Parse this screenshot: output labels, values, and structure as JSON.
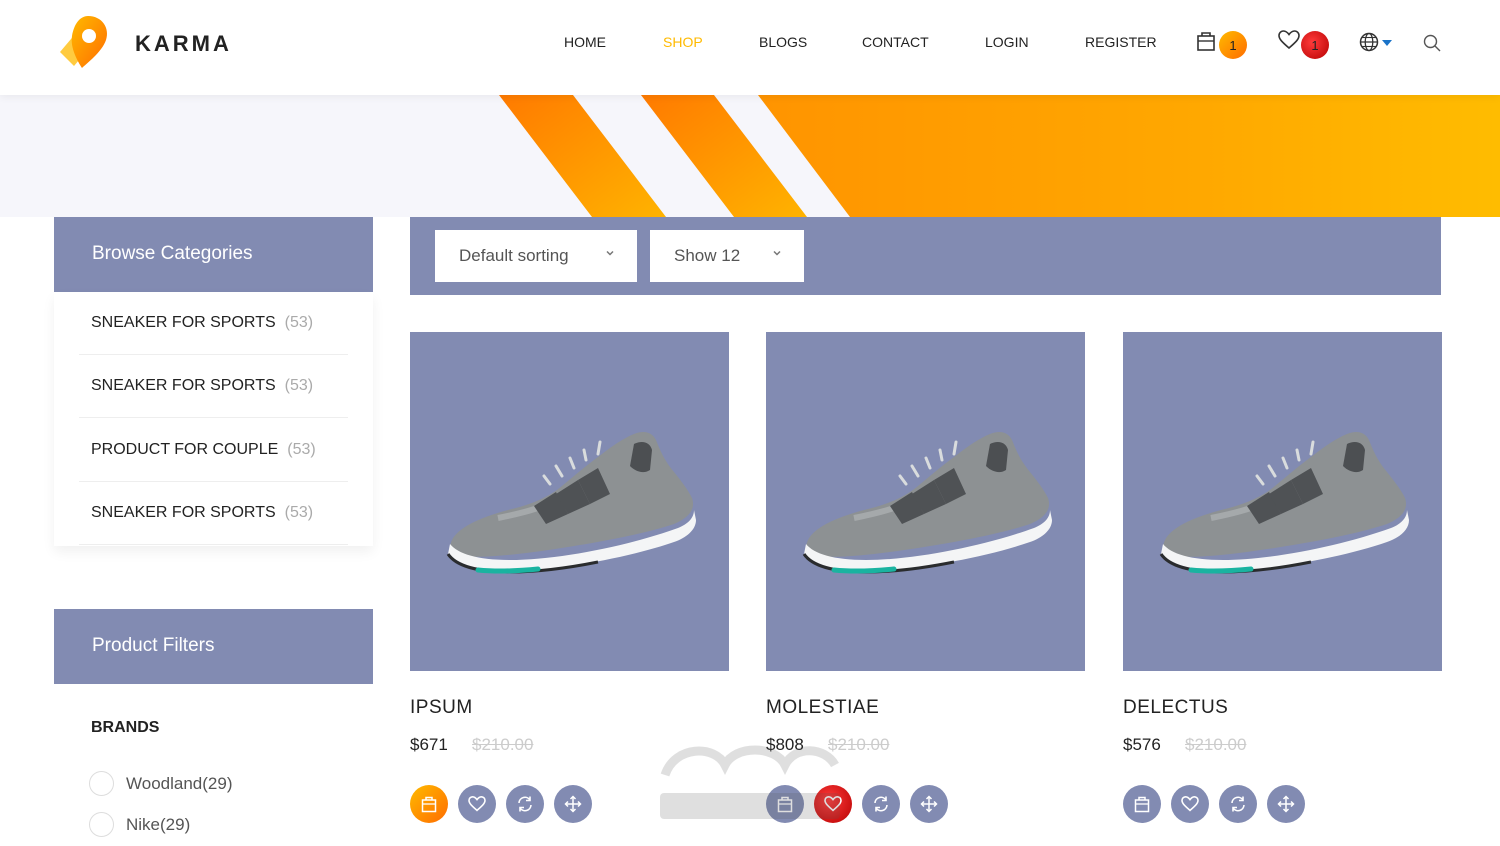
{
  "brand": {
    "name": "KARMA"
  },
  "nav": {
    "items": [
      "HOME",
      "SHOP",
      "BLOGS",
      "CONTACT",
      "LOGIN",
      "REGISTER"
    ],
    "active": "SHOP"
  },
  "header_icons": {
    "cart_count": "1",
    "wishlist_count": "1"
  },
  "sidebar": {
    "categories_title": "Browse Categories",
    "categories": [
      {
        "label": "SNEAKER FOR SPORTS",
        "count": "(53)"
      },
      {
        "label": "SNEAKER FOR SPORTS",
        "count": "(53)"
      },
      {
        "label": "PRODUCT FOR COUPLE",
        "count": "(53)"
      },
      {
        "label": "SNEAKER FOR SPORTS",
        "count": "(53)"
      }
    ],
    "filters_title": "Product Filters",
    "brands_title": "BRANDS",
    "brands": [
      {
        "label": "Woodland(29)"
      },
      {
        "label": "Nike(29)"
      }
    ]
  },
  "toolbar": {
    "sorting": "Default sorting",
    "show": "Show 12"
  },
  "products": [
    {
      "title": "IPSUM",
      "price": "$671",
      "old_price": "$210.00"
    },
    {
      "title": "MOLESTIAE",
      "price": "$808",
      "old_price": "$210.00"
    },
    {
      "title": "DELECTUS",
      "price": "$576",
      "old_price": "$210.00"
    }
  ],
  "colors": {
    "accent": "#ffba00",
    "accent_dark": "#ff6c00",
    "panel": "#828bb2",
    "wishlist_active": "#d81e1e"
  }
}
